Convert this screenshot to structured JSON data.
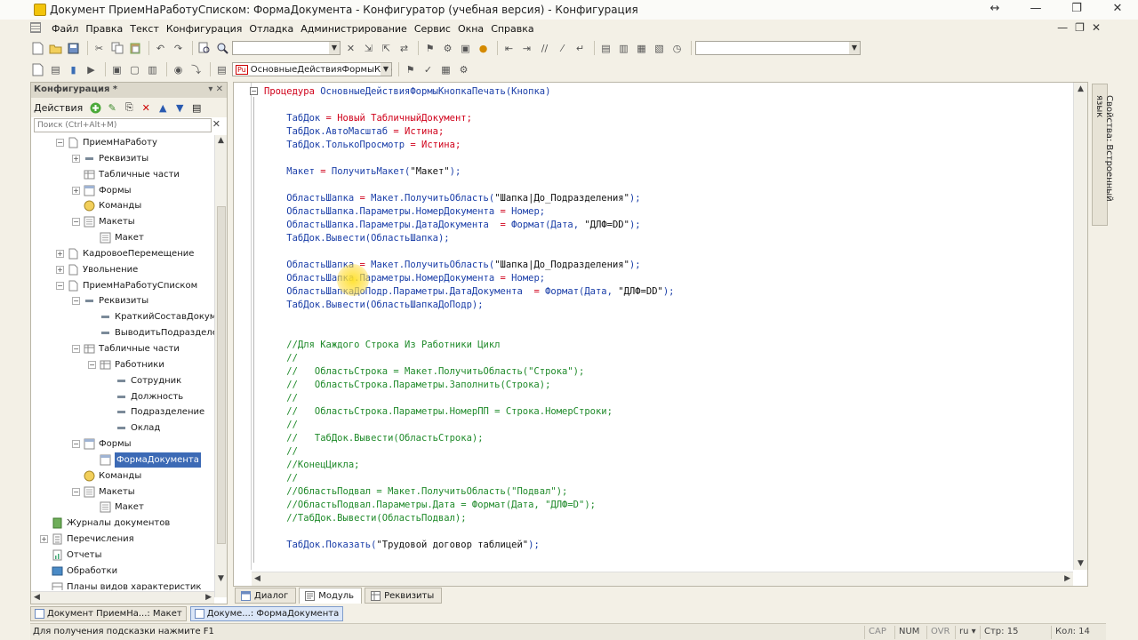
{
  "window": {
    "title": "Документ ПриемНаРаботуСписком: ФормаДокумента - Конфигуратор (учебная версия) - Конфигурация",
    "controls": [
      "↔",
      "—",
      "❐",
      "✕"
    ]
  },
  "menu": {
    "items": [
      "Файл",
      "Правка",
      "Текст",
      "Конфигурация",
      "Отладка",
      "Администрирование",
      "Сервис",
      "Окна",
      "Справка"
    ],
    "mdi_controls": [
      "—",
      "❐",
      "✕"
    ]
  },
  "toolbar": {
    "method_combo": "ОсновныеДействияФормыКно",
    "method_badge": "Pu"
  },
  "left_panel": {
    "title": "Конфигурация *",
    "header_icons": "▾ ✕",
    "actions_label": "Действия",
    "search_placeholder": "Поиск (Ctrl+Alt+M)",
    "search_clear": "✕",
    "tree": [
      {
        "level": 1,
        "exp": "−",
        "icon": "doc",
        "label": "ПриемНаРаботу"
      },
      {
        "level": 2,
        "exp": "+",
        "icon": "attr",
        "label": "Реквизиты"
      },
      {
        "level": 2,
        "exp": "",
        "icon": "table",
        "label": "Табличные части"
      },
      {
        "level": 2,
        "exp": "+",
        "icon": "form",
        "label": "Формы"
      },
      {
        "level": 2,
        "exp": "",
        "icon": "cmd",
        "label": "Команды"
      },
      {
        "level": 2,
        "exp": "−",
        "icon": "layout",
        "label": "Макеты"
      },
      {
        "level": 3,
        "exp": "",
        "icon": "layout",
        "label": "Макет"
      },
      {
        "level": 1,
        "exp": "+",
        "icon": "doc",
        "label": "КадровоеПеремещение"
      },
      {
        "level": 1,
        "exp": "+",
        "icon": "doc",
        "label": "Увольнение"
      },
      {
        "level": 1,
        "exp": "−",
        "icon": "doc",
        "label": "ПриемНаРаботуСписком"
      },
      {
        "level": 2,
        "exp": "−",
        "icon": "attr",
        "label": "Реквизиты"
      },
      {
        "level": 3,
        "exp": "",
        "icon": "attr",
        "label": "КраткийСоставДокуме"
      },
      {
        "level": 3,
        "exp": "",
        "icon": "attr",
        "label": "ВыводитьПодразделен"
      },
      {
        "level": 2,
        "exp": "−",
        "icon": "table",
        "label": "Табличные части"
      },
      {
        "level": 3,
        "exp": "−",
        "icon": "table",
        "label": "Работники"
      },
      {
        "level": 4,
        "exp": "",
        "icon": "attr",
        "label": "Сотрудник"
      },
      {
        "level": 4,
        "exp": "",
        "icon": "attr",
        "label": "Должность"
      },
      {
        "level": 4,
        "exp": "",
        "icon": "attr",
        "label": "Подразделение"
      },
      {
        "level": 4,
        "exp": "",
        "icon": "attr",
        "label": "Оклад"
      },
      {
        "level": 2,
        "exp": "−",
        "icon": "form",
        "label": "Формы"
      },
      {
        "level": 3,
        "exp": "",
        "icon": "form",
        "label": "ФормаДокумента",
        "selected": true
      },
      {
        "level": 2,
        "exp": "",
        "icon": "cmd",
        "label": "Команды"
      },
      {
        "level": 2,
        "exp": "−",
        "icon": "layout",
        "label": "Макеты"
      },
      {
        "level": 3,
        "exp": "",
        "icon": "layout",
        "label": "Макет"
      },
      {
        "level": 0,
        "exp": "",
        "icon": "journal",
        "label": "Журналы документов"
      },
      {
        "level": 0,
        "exp": "+",
        "icon": "enum",
        "label": "Перечисления"
      },
      {
        "level": 0,
        "exp": "",
        "icon": "report",
        "label": "Отчеты"
      },
      {
        "level": 0,
        "exp": "",
        "icon": "proc",
        "label": "Обработки"
      },
      {
        "level": 0,
        "exp": "",
        "icon": "chart",
        "label": "Планы видов характеристик"
      }
    ]
  },
  "editor": {
    "fold_marker": "−",
    "lines": [
      [
        {
          "t": "Процедура ",
          "c": "kw"
        },
        {
          "t": "ОсновныеДействияФормыКнопкаПечать",
          "c": "id"
        },
        {
          "t": "(Кнопка)",
          "c": "id"
        }
      ],
      [],
      [
        {
          "t": "    ТабДок ",
          "c": "id"
        },
        {
          "t": "= ",
          "c": "kw"
        },
        {
          "t": "Новый ТабличныйДокумент",
          "c": "kw"
        },
        {
          "t": ";",
          "c": "kw"
        }
      ],
      [
        {
          "t": "    ТабДок.АвтоМасштаб ",
          "c": "id"
        },
        {
          "t": "= Истина;",
          "c": "kw"
        }
      ],
      [
        {
          "t": "    ТабДок.ТолькоПросмотр ",
          "c": "id"
        },
        {
          "t": "= Истина;",
          "c": "kw"
        }
      ],
      [],
      [
        {
          "t": "    Макет ",
          "c": "id"
        },
        {
          "t": "= ",
          "c": "kw"
        },
        {
          "t": "ПолучитьМакет(",
          "c": "id"
        },
        {
          "t": "\"Макет\"",
          "c": "st"
        },
        {
          "t": ");",
          "c": "id"
        }
      ],
      [],
      [
        {
          "t": "    ОбластьШапка ",
          "c": "id"
        },
        {
          "t": "= ",
          "c": "kw"
        },
        {
          "t": "Макет.ПолучитьОбласть(",
          "c": "id"
        },
        {
          "t": "\"Шапка|До_Подразделения\"",
          "c": "st"
        },
        {
          "t": ");",
          "c": "id"
        }
      ],
      [
        {
          "t": "    ОбластьШапка.Параметры.НомерДокумента ",
          "c": "id"
        },
        {
          "t": "= ",
          "c": "kw"
        },
        {
          "t": "Номер;",
          "c": "id"
        }
      ],
      [
        {
          "t": "    ОбластьШапка.Параметры.ДатаДокумента  ",
          "c": "id"
        },
        {
          "t": "= ",
          "c": "kw"
        },
        {
          "t": "Формат(Дата, ",
          "c": "id"
        },
        {
          "t": "\"ДЛФ=DD\"",
          "c": "st"
        },
        {
          "t": ");",
          "c": "id"
        }
      ],
      [
        {
          "t": "    ТабДок.Вывести(ОбластьШапка);",
          "c": "id"
        }
      ],
      [],
      [
        {
          "t": "    ОбластьШапка ",
          "c": "id"
        },
        {
          "t": "= ",
          "c": "kw"
        },
        {
          "t": "Макет.ПолучитьОбласть(",
          "c": "id"
        },
        {
          "t": "\"Шапка|До_Подразделения\"",
          "c": "st"
        },
        {
          "t": ");",
          "c": "id"
        }
      ],
      [
        {
          "t": "    ОбластьШапка.Параметры.НомерДокумента ",
          "c": "id"
        },
        {
          "t": "= ",
          "c": "kw"
        },
        {
          "t": "Номер;",
          "c": "id"
        }
      ],
      [
        {
          "t": "    ОбластьШапкаДоПодр.Параметры.ДатаДокумента  ",
          "c": "id"
        },
        {
          "t": "= ",
          "c": "kw"
        },
        {
          "t": "Формат(Дата, ",
          "c": "id"
        },
        {
          "t": "\"ДЛФ=DD\"",
          "c": "st"
        },
        {
          "t": ");",
          "c": "id"
        }
      ],
      [
        {
          "t": "    ТабДок.Вывести(ОбластьШапкаДоПодр);",
          "c": "id"
        }
      ],
      [],
      [],
      [
        {
          "t": "    //Для Каждого Строка Из Работники Цикл",
          "c": "cm"
        }
      ],
      [
        {
          "t": "    //",
          "c": "cm"
        }
      ],
      [
        {
          "t": "    //   ОбластьСтрока = Макет.ПолучитьОбласть(\"Строка\");",
          "c": "cm"
        }
      ],
      [
        {
          "t": "    //   ОбластьСтрока.Параметры.Заполнить(Строка);",
          "c": "cm"
        }
      ],
      [
        {
          "t": "    //",
          "c": "cm"
        }
      ],
      [
        {
          "t": "    //   ОбластьСтрока.Параметры.НомерПП = Строка.НомерСтроки;",
          "c": "cm"
        }
      ],
      [
        {
          "t": "    //",
          "c": "cm"
        }
      ],
      [
        {
          "t": "    //   ТабДок.Вывести(ОбластьСтрока);",
          "c": "cm"
        }
      ],
      [
        {
          "t": "    //",
          "c": "cm"
        }
      ],
      [
        {
          "t": "    //КонецЦикла;",
          "c": "cm"
        }
      ],
      [
        {
          "t": "    //",
          "c": "cm"
        }
      ],
      [
        {
          "t": "    //ОбластьПодвал = Макет.ПолучитьОбласть(\"Подвал\");",
          "c": "cm"
        }
      ],
      [
        {
          "t": "    //ОбластьПодвал.Параметры.Дата = Формат(Дата, \"ДЛФ=D\");",
          "c": "cm"
        }
      ],
      [
        {
          "t": "    //ТабДок.Вывести(ОбластьПодвал);",
          "c": "cm"
        }
      ],
      [],
      [
        {
          "t": "    ТабДок.Показать(",
          "c": "id"
        },
        {
          "t": "\"Трудовой договор таблицей\"",
          "c": "st"
        },
        {
          "t": ");",
          "c": "id"
        }
      ]
    ]
  },
  "right_panel": {
    "label": "Свойства: Встроенный язык"
  },
  "editor_tabs": [
    {
      "label": "Диалог",
      "active": false
    },
    {
      "label": "Модуль",
      "active": true
    },
    {
      "label": "Реквизиты",
      "active": false
    }
  ],
  "window_tabs": [
    {
      "label": "Документ ПриемНа...: Макет",
      "active": false
    },
    {
      "label": "Докуме...: ФормаДокумента",
      "active": true
    }
  ],
  "status": {
    "hint": "Для получения подсказки нажмите F1",
    "cap": "CAP",
    "num": "NUM",
    "ovr": "OVR",
    "lang": "ru",
    "line": "Стр: 15",
    "col": "Кол: 14"
  },
  "colors": {
    "keyword": "#d0021b",
    "identifier": "#1a3ea8",
    "comment": "#1f8a2a",
    "selection": "#3c6ab5"
  }
}
